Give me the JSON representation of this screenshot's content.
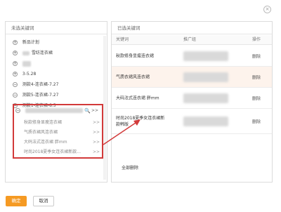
{
  "close_symbol": "×",
  "left_panel": {
    "title": "未选关键词",
    "items": [
      {
        "toggle": "+",
        "label": "新品计划"
      },
      {
        "toggle": "+",
        "label": "雪纺连衣裙",
        "label_blurred_prefix": true
      },
      {
        "toggle": "+",
        "label": "",
        "label_blurred_prefix": true
      },
      {
        "toggle": "+",
        "label": "3-5.28"
      },
      {
        "toggle": "−",
        "label": "测款4-连衣裙-7.27"
      },
      {
        "toggle": "−",
        "label": "测款5-连衣裙-7.27"
      },
      {
        "toggle": "−",
        "label": "测款1-连衣裙-8.5"
      }
    ],
    "expanded": {
      "toggle": "−",
      "search_symbol": "🔍",
      "move_all_symbol": ">>",
      "keywords": [
        {
          "label": "秋款修身显瘦连衣裙",
          "move_symbol": ">>"
        },
        {
          "label": "气质衣裙风连衣裙",
          "move_symbol": ">>"
        },
        {
          "label": "大码法式连衣裙 胖mm",
          "move_symbol": ">>"
        },
        {
          "label": "时尚2018夏季女连衣裙新款...",
          "move_symbol": ">>"
        }
      ]
    }
  },
  "right_panel": {
    "title": "已选关键词",
    "columns": {
      "keyword": "关键词",
      "plan": "推广组",
      "op": "操作"
    },
    "rows": [
      {
        "keyword": "秋款修身显瘦连衣裙",
        "delete": "删除",
        "active": false
      },
      {
        "keyword": "气质衣裙风连衣裙",
        "delete": "删除",
        "active": true
      },
      {
        "keyword": "大码法式连衣裙 胖mm",
        "delete": "删除",
        "active": false
      },
      {
        "keyword": "时尚2018夏季女连衣裙新款韩版",
        "delete": "删除",
        "active": false
      }
    ],
    "clear_all": "全部删除"
  },
  "buttons": {
    "ok": "确定",
    "cancel": "取消"
  },
  "colors": {
    "primary": "#f59a23",
    "highlight": "#d23a3a"
  }
}
